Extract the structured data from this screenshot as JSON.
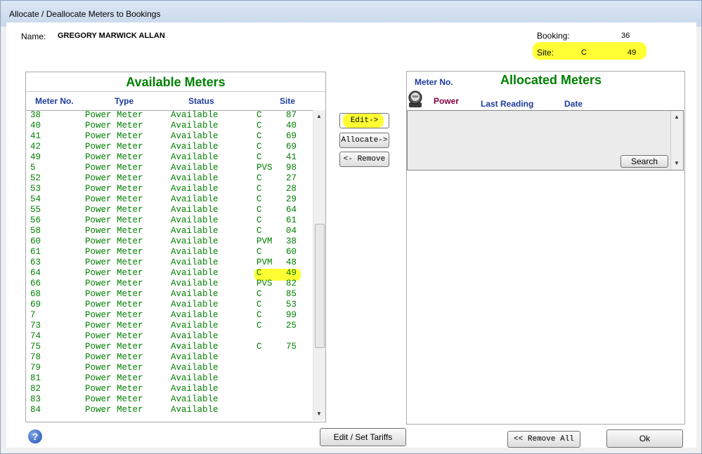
{
  "window": {
    "title": "Allocate / Deallocate Meters to Bookings"
  },
  "header": {
    "name_label": "Name:",
    "name_value": "GREGORY MARWICK ALLAN",
    "booking_label": "Booking:",
    "booking_value": "36",
    "site_label": "Site:",
    "site_code": "C",
    "site_number": "49"
  },
  "available": {
    "title": "Available Meters",
    "columns": [
      "Meter No.",
      "Type",
      "Status",
      "Site"
    ],
    "rows": [
      {
        "no": "38",
        "type": "Power Meter",
        "status": "Available",
        "site": "C",
        "num": "87"
      },
      {
        "no": "40",
        "type": "Power Meter",
        "status": "Available",
        "site": "C",
        "num": "40"
      },
      {
        "no": "41",
        "type": "Power Meter",
        "status": "Available",
        "site": "C",
        "num": "69"
      },
      {
        "no": "42",
        "type": "Power Meter",
        "status": "Available",
        "site": "C",
        "num": "69"
      },
      {
        "no": "49",
        "type": "Power Meter",
        "status": "Available",
        "site": "C",
        "num": "41"
      },
      {
        "no": "5",
        "type": "Power Meter",
        "status": "Available",
        "site": "PVS",
        "num": "98"
      },
      {
        "no": "52",
        "type": "Power Meter",
        "status": "Available",
        "site": "C",
        "num": "27"
      },
      {
        "no": "53",
        "type": "Power Meter",
        "status": "Available",
        "site": "C",
        "num": "28"
      },
      {
        "no": "54",
        "type": "Power Meter",
        "status": "Available",
        "site": "C",
        "num": "29"
      },
      {
        "no": "55",
        "type": "Power Meter",
        "status": "Available",
        "site": "C",
        "num": "64"
      },
      {
        "no": "56",
        "type": "Power Meter",
        "status": "Available",
        "site": "C",
        "num": "61"
      },
      {
        "no": "58",
        "type": "Power Meter",
        "status": "Available",
        "site": "C",
        "num": "04"
      },
      {
        "no": "60",
        "type": "Power Meter",
        "status": "Available",
        "site": "PVM",
        "num": "38"
      },
      {
        "no": "61",
        "type": "Power Meter",
        "status": "Available",
        "site": "C",
        "num": "60"
      },
      {
        "no": "63",
        "type": "Power Meter",
        "status": "Available",
        "site": "PVM",
        "num": "48"
      },
      {
        "no": "64",
        "type": "Power Meter",
        "status": "Available",
        "site": "C",
        "num": "49"
      },
      {
        "no": "66",
        "type": "Power Meter",
        "status": "Available",
        "site": "PVS",
        "num": "82"
      },
      {
        "no": "68",
        "type": "Power Meter",
        "status": "Available",
        "site": "C",
        "num": "85"
      },
      {
        "no": "69",
        "type": "Power Meter",
        "status": "Available",
        "site": "C",
        "num": "53"
      },
      {
        "no": "7",
        "type": "Power Meter",
        "status": "Available",
        "site": "C",
        "num": "99"
      },
      {
        "no": "73",
        "type": "Power Meter",
        "status": "Available",
        "site": "C",
        "num": "25"
      },
      {
        "no": "74",
        "type": "Power Meter",
        "status": "Available",
        "site": "",
        "num": ""
      },
      {
        "no": "75",
        "type": "Power Meter",
        "status": "Available",
        "site": "C",
        "num": "75"
      },
      {
        "no": "78",
        "type": "Power Meter",
        "status": "Available",
        "site": "",
        "num": ""
      },
      {
        "no": "79",
        "type": "Power Meter",
        "status": "Available",
        "site": "",
        "num": ""
      },
      {
        "no": "81",
        "type": "Power Meter",
        "status": "Available",
        "site": "",
        "num": ""
      },
      {
        "no": "82",
        "type": "Power Meter",
        "status": "Available",
        "site": "",
        "num": ""
      },
      {
        "no": "83",
        "type": "Power Meter",
        "status": "Available",
        "site": "",
        "num": ""
      },
      {
        "no": "84",
        "type": "Power Meter",
        "status": "Available",
        "site": "",
        "num": ""
      }
    ]
  },
  "middle_buttons": {
    "edit": "Edit->",
    "allocate": "Allocate->",
    "remove": "<- Remove"
  },
  "allocated": {
    "title": "Allocated Meters",
    "meter_no_label": "Meter No.",
    "power_label": "Power",
    "last_reading_label": "Last Reading",
    "date_label": "Date",
    "search_button": "Search"
  },
  "footer": {
    "help_icon": "?",
    "edit_tariffs": "Edit / Set Tariffs",
    "remove_all": "<< Remove All",
    "ok": "Ok"
  },
  "colors": {
    "green_text": "#008000",
    "header_blue": "#1e3c9c",
    "highlight": "#ffff33",
    "power_maroon": "#800040"
  }
}
